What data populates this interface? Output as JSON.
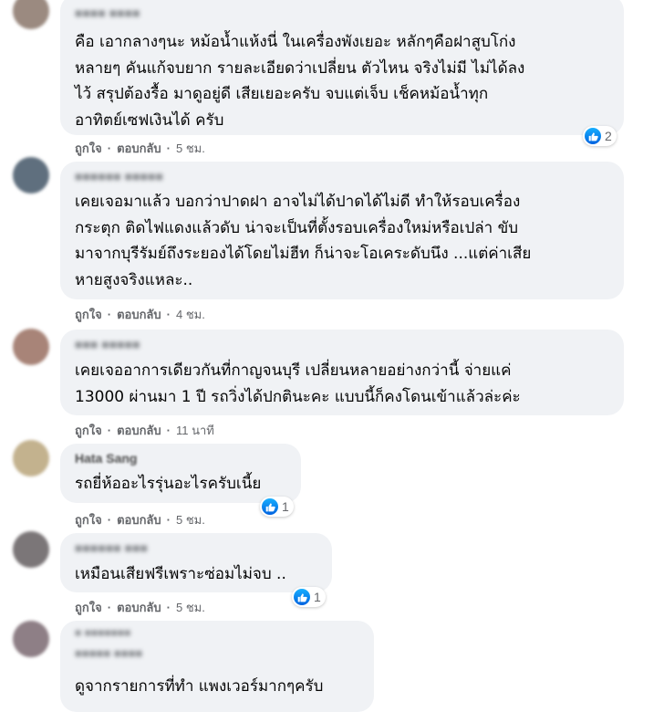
{
  "actions": {
    "like": "ถูกใจ",
    "reply": "ตอบกลับ",
    "separator": "·"
  },
  "comments": [
    {
      "author": "■■■■ ■■■■",
      "text": "คือ เอากลางๆนะ หม้อน้ำแห้งนี่ ในเครื่องพังเยอะ หลักๆคือฝาสูบโก่ง\nหลายๆ คันแก้จบยาก รายละเอียดว่าเปลี่ยน ตัวไหน จริงไม่มี ไม่ได้ลง\nไว้ สรุปต้องรื้อ มาดูอยู่ดี เสียเยอะครับ จบแต่เจ็บ เช็คหม้อน้ำทุก\nอาทิตย์เซฟเงินได้ ครับ",
      "time": "5 ชม.",
      "reactions": 2,
      "avatar_color": "#9b8a80"
    },
    {
      "author": "■■■■■■ ■■■■■",
      "text": "เคยเจอมาแล้ว บอกว่าปาดฝา อาจไม่ได้ปาดได้ไม่ดี ทำให้รอบเครื่อง\nกระตุก ติดไฟแดงแล้วดับ น่าจะเป็นที่ตั้งรอบเครื่องใหม่หรือเปล่า ขับ\nมาจากบุรีรัมย์ถึงระยองได้โดยไม่ฮีท ก็น่าจะโอเคระดับนึง ...แต่ค่าเสีย\nหายสูงจริงแหละ..",
      "time": "4 ชม.",
      "reactions": null,
      "avatar_color": "#5f6f7e"
    },
    {
      "author": "■■■ ■■■■■",
      "text": "เคยเจออาการเดียวกันที่กาญจนบุรี เปลี่ยนหลายอย่างกว่านี้ จ่ายแค่\n13000 ผ่านมา 1 ปี รถวิ่งได้ปกตินะคะ แบบนี้ก็คงโดนเข้าแล้วล่ะค่ะ",
      "time": "11 นาที",
      "reactions": null,
      "avatar_color": "#a88478"
    },
    {
      "author": "Hata Sang",
      "text": "รถยี่ห้ออะไรรุ่นอะไรครับเนี้ย",
      "time": "5 ชม.",
      "reactions": 1,
      "avatar_color": "#c3b28e"
    },
    {
      "author": "■■■■■■ ■■■",
      "text": "เหมือนเสียฟรีเพราะซ่อมไม่จบ ..",
      "time": "5 ชม.",
      "reactions": 1,
      "avatar_color": "#7b7678"
    },
    {
      "author": "■ ■■■■■■■",
      "author2": "■■■■■ ■■■■",
      "text": "ดูจากรายการที่ทำ แพงเวอร์มากๆครับ",
      "time": null,
      "reactions": null,
      "avatar_color": "#8e7f86"
    }
  ]
}
